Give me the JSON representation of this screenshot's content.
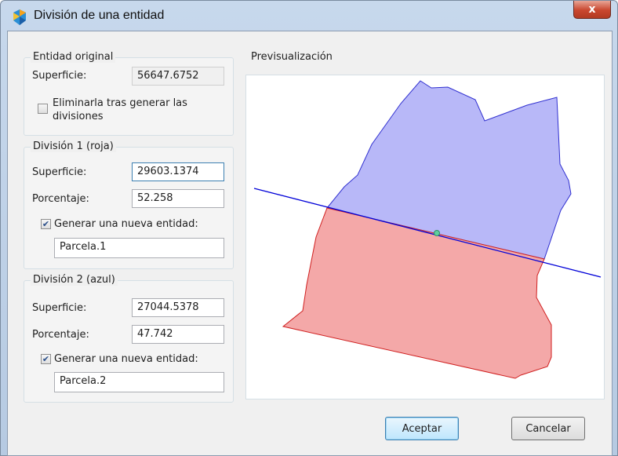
{
  "window": {
    "title": "División de una entidad",
    "close_glyph": "x"
  },
  "original": {
    "title": "Entidad original",
    "area_label": "Superficie:",
    "area_value": "56647.6752",
    "delete_label_line1": "Eliminarla tras generar las",
    "delete_label_line2": "divisiones",
    "delete_checked": false
  },
  "division1": {
    "title": "División 1  (roja)",
    "area_label": "Superficie:",
    "area_value": "29603.1374",
    "percent_label": "Porcentaje:",
    "percent_value": "52.258",
    "generate_label": "Generar una nueva entidad:",
    "generate_checked": true,
    "entity_name": "Parcela.1",
    "color": "#f0a0a0"
  },
  "division2": {
    "title": "División 2  (azul)",
    "area_label": "Superficie:",
    "area_value": "27044.5378",
    "percent_label": "Porcentaje:",
    "percent_value": "47.742",
    "generate_label": "Generar una nueva entidad:",
    "generate_checked": true,
    "entity_name": "Parcela.2",
    "color": "#b8b8f8"
  },
  "preview": {
    "title": "Previsualización"
  },
  "buttons": {
    "ok": "Aceptar",
    "cancel": "Cancelar"
  }
}
